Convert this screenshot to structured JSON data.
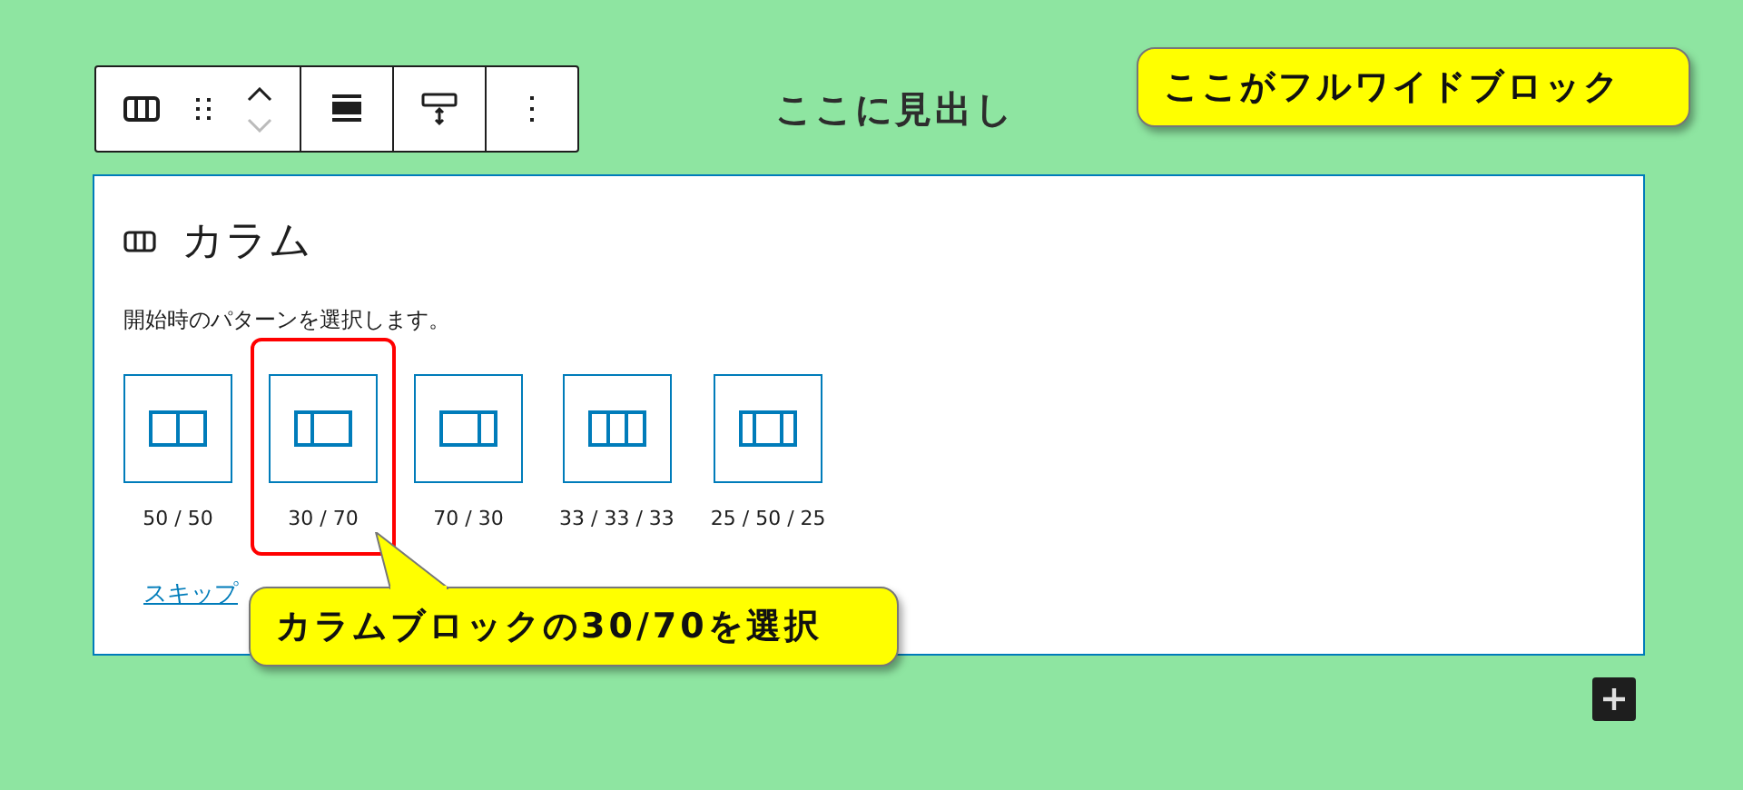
{
  "toolbar": {
    "move_up": {
      "disabled": false
    },
    "move_down": {
      "disabled": true
    }
  },
  "heading": "ここに見出し",
  "callouts": [
    {
      "text": "ここがフルワイドブロック"
    },
    {
      "text": "カラムブロックの30/70を選択"
    }
  ],
  "block": {
    "title": "カラム",
    "description": "開始時のパターンを選択します。",
    "options": [
      {
        "label": "50 / 50",
        "highlighted": false
      },
      {
        "label": "30 / 70",
        "highlighted": true
      },
      {
        "label": "70 / 30",
        "highlighted": false
      },
      {
        "label": "33 / 33 / 33",
        "highlighted": false
      },
      {
        "label": "25 / 50 / 25",
        "highlighted": false
      }
    ],
    "skip_link": "スキップ"
  }
}
